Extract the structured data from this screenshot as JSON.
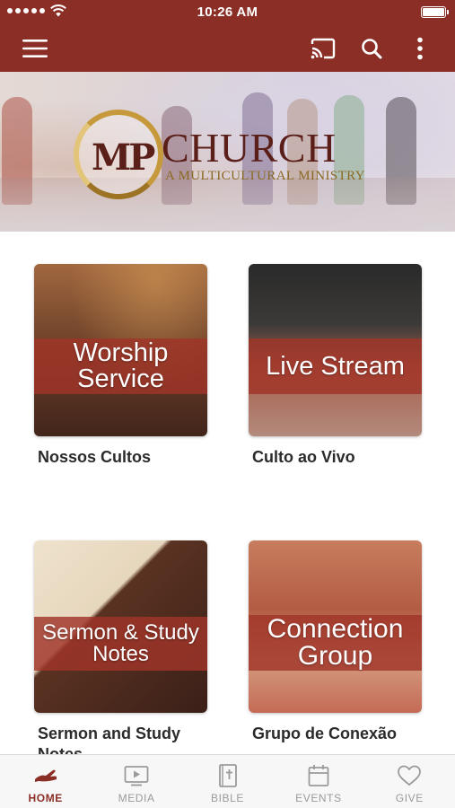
{
  "status_bar": {
    "time": "10:26 AM"
  },
  "app_bar": {
    "icons": [
      "menu-icon",
      "cast-icon",
      "search-icon",
      "more-vertical-icon"
    ]
  },
  "banner": {
    "logo_mark": "MP",
    "logo_title": "CHURCH",
    "logo_tagline": "A MULTICULTURAL MINISTRY"
  },
  "tiles": [
    {
      "image_text_1": "Worship",
      "image_text_2": "Service",
      "caption": "Nossos Cultos"
    },
    {
      "image_text_1": "Live Stream",
      "image_text_2": "",
      "caption": "Culto ao Vivo"
    },
    {
      "image_text_1": "Sermon & Study",
      "image_text_2": "Notes",
      "caption": "Sermon and Study Notes"
    },
    {
      "image_text_1": "Connection",
      "image_text_2": "Group",
      "caption": "Grupo de Conexão"
    }
  ],
  "tab_bar": {
    "active": "HOME",
    "tabs": [
      {
        "label": "HOME",
        "icon": "home-hand-icon"
      },
      {
        "label": "MEDIA",
        "icon": "media-play-icon"
      },
      {
        "label": "BIBLE",
        "icon": "bible-icon"
      },
      {
        "label": "EVENTS",
        "icon": "calendar-icon"
      },
      {
        "label": "GIVE",
        "icon": "heart-icon"
      }
    ]
  },
  "colors": {
    "brand": "#8a2e26",
    "band_overlay": "#a03428",
    "tab_inactive": "#9a9a9a"
  }
}
